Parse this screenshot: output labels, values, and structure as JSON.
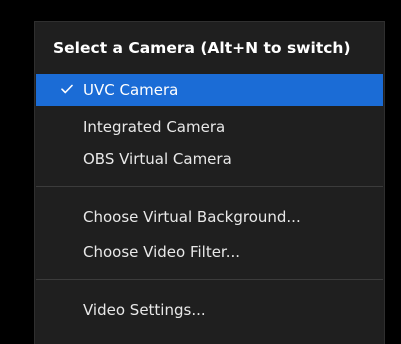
{
  "menu": {
    "header": "Select a Camera (Alt+N to switch)",
    "cameras": [
      {
        "label": "UVC Camera",
        "selected": true
      },
      {
        "label": "Integrated Camera",
        "selected": false
      },
      {
        "label": "OBS Virtual Camera",
        "selected": false
      }
    ],
    "background_items": [
      {
        "label": "Choose Virtual Background..."
      },
      {
        "label": "Choose Video Filter..."
      }
    ],
    "settings_item": {
      "label": "Video Settings..."
    }
  },
  "colors": {
    "menu_background": "#1f1f1f",
    "selected_highlight": "#1b6cd6",
    "separator": "#3b3b3b",
    "text": "#e8e8e8"
  },
  "icons": {
    "selected_marker": "checkmark-icon"
  }
}
